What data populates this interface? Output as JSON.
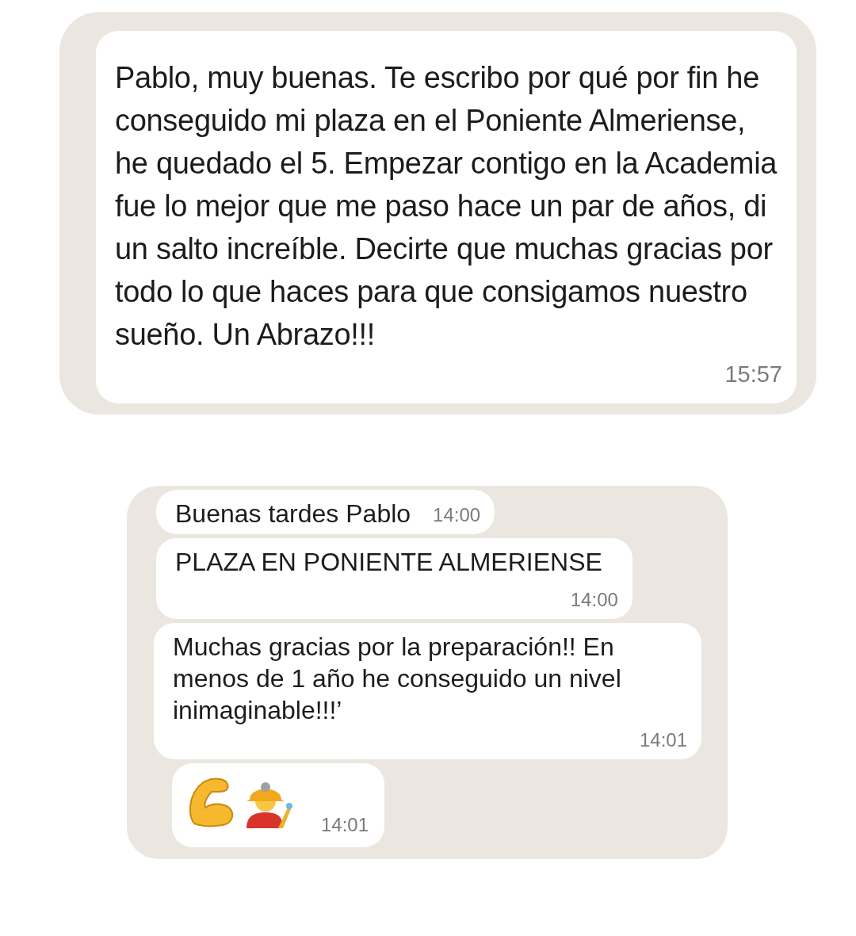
{
  "screenshots": [
    {
      "messages": [
        {
          "kind": "text",
          "text": "Pablo, muy buenas. Te escribo por qué por fin he conseguido mi plaza en el Poniente Almeriense, he quedado el 5. Empezar contigo en la Academia fue lo mejor que me paso hace un par de años, di un salto increíble. Decirte que muchas gracias por todo lo que haces para que consigamos nuestro sueño. Un Abrazo!!!",
          "time": "15:57"
        }
      ]
    },
    {
      "messages": [
        {
          "kind": "text",
          "text": "Buenas tardes Pablo",
          "time": "14:00"
        },
        {
          "kind": "text",
          "text": "PLAZA EN PONIENTE ALMERIENSE",
          "time": "14:00"
        },
        {
          "kind": "text",
          "text": "Muchas gracias por la preparación!! En menos de 1 año he conseguido un nivel inimaginable!!!’",
          "time": "14:01"
        },
        {
          "kind": "emoji",
          "time": "14:01"
        }
      ]
    }
  ]
}
